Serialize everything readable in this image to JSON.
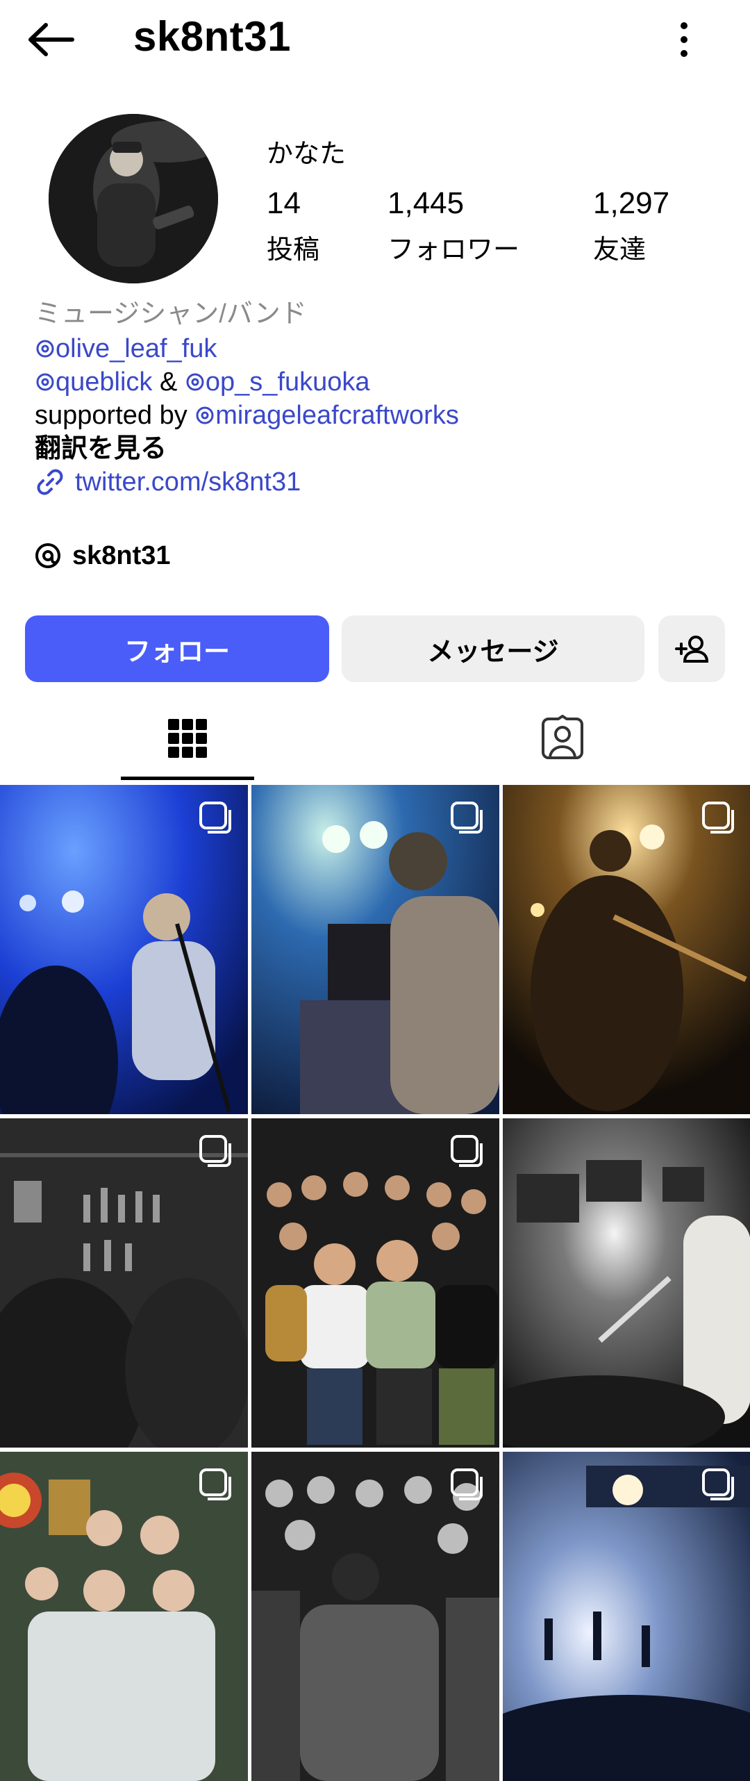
{
  "header": {
    "username": "sk8nt31"
  },
  "profile": {
    "display_name": "かなた",
    "stats": [
      {
        "value": "14",
        "label": "投稿"
      },
      {
        "value": "1,445",
        "label": "フォロワー"
      },
      {
        "value": "1,297",
        "label": "友達"
      }
    ]
  },
  "bio": {
    "category": "ミュージシャン/バンド",
    "mention1": "olive_leaf_fuk",
    "mention2": "queblick",
    "amp": "&",
    "mention3": "op_s_fukuoka",
    "supported_by": "supported by",
    "mention4": "mirageleafcraftworks",
    "translate": "翻訳を見る",
    "link": "twitter.com/sk8nt31"
  },
  "threads": {
    "handle": "sk8nt31"
  },
  "actions": {
    "follow": "フォロー",
    "message": "メッセージ"
  },
  "colors": {
    "accent": "#4a5df9",
    "link": "#3a48c9",
    "secondary_text": "#8a8a8a"
  },
  "posts": [
    {
      "theme": "blue-stage"
    },
    {
      "theme": "blue-guitar"
    },
    {
      "theme": "amber-stage"
    },
    {
      "theme": "bw-bar"
    },
    {
      "theme": "color-group"
    },
    {
      "theme": "bw-stage"
    },
    {
      "theme": "color-crowd"
    },
    {
      "theme": "bw-crowd"
    },
    {
      "theme": "blue-light"
    }
  ]
}
